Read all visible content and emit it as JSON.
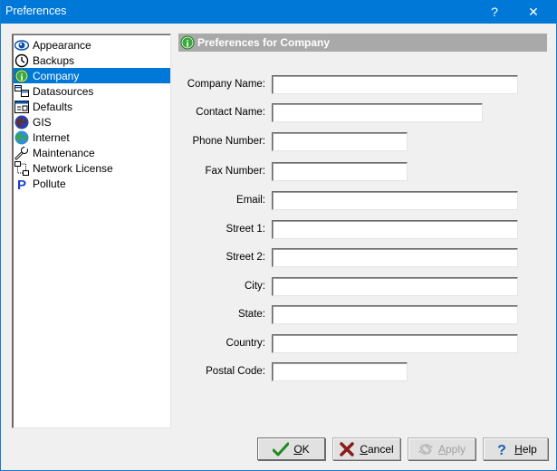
{
  "window": {
    "title": "Preferences",
    "help_button": "?",
    "close_button": "✕"
  },
  "sidebar": {
    "selected_index": 2,
    "items": [
      {
        "label": "Appearance",
        "icon": "eye-icon"
      },
      {
        "label": "Backups",
        "icon": "clock-icon"
      },
      {
        "label": "Company",
        "icon": "info-icon"
      },
      {
        "label": "Datasources",
        "icon": "datasources-icon"
      },
      {
        "label": "Defaults",
        "icon": "defaults-window-icon"
      },
      {
        "label": "GIS",
        "icon": "gis-globe-icon"
      },
      {
        "label": "Internet",
        "icon": "internet-globe-icon"
      },
      {
        "label": "Maintenance",
        "icon": "wrench-icon"
      },
      {
        "label": "Network License",
        "icon": "network-icon"
      },
      {
        "label": "Pollute",
        "icon": "pollute-p-icon"
      }
    ]
  },
  "panel": {
    "title": "Preferences for Company",
    "fields": [
      {
        "label": "Company Name:",
        "value": "",
        "placeholder": ""
      },
      {
        "label": "Contact Name:",
        "value": "",
        "placeholder": ""
      },
      {
        "label": "Phone Number:",
        "value": "",
        "placeholder": ""
      },
      {
        "label": "Fax Number:",
        "value": "",
        "placeholder": ""
      },
      {
        "label": "Email:",
        "value": "",
        "placeholder": ""
      },
      {
        "label": "Street 1:",
        "value": "",
        "placeholder": ""
      },
      {
        "label": "Street 2:",
        "value": "",
        "placeholder": ""
      },
      {
        "label": "City:",
        "value": "",
        "placeholder": ""
      },
      {
        "label": "State:",
        "value": "",
        "placeholder": ""
      },
      {
        "label": "Country:",
        "value": "",
        "placeholder": ""
      },
      {
        "label": "Postal Code:",
        "value": "",
        "placeholder": ""
      }
    ]
  },
  "buttons": {
    "ok": {
      "mnemonic": "O",
      "rest": "K"
    },
    "cancel": {
      "mnemonic": "C",
      "rest": "ancel"
    },
    "apply": {
      "mnemonic": "A",
      "rest": "pply",
      "disabled": true
    },
    "help": {
      "mnemonic": "H",
      "rest": "elp"
    }
  },
  "colors": {
    "titlebar": "#0078d7",
    "selection": "#0078d7",
    "header_bar": "#a9a9a9",
    "ok_check": "#1e8a1e",
    "cancel_x": "#8b1a1a",
    "help_q": "#1a5fb4"
  }
}
